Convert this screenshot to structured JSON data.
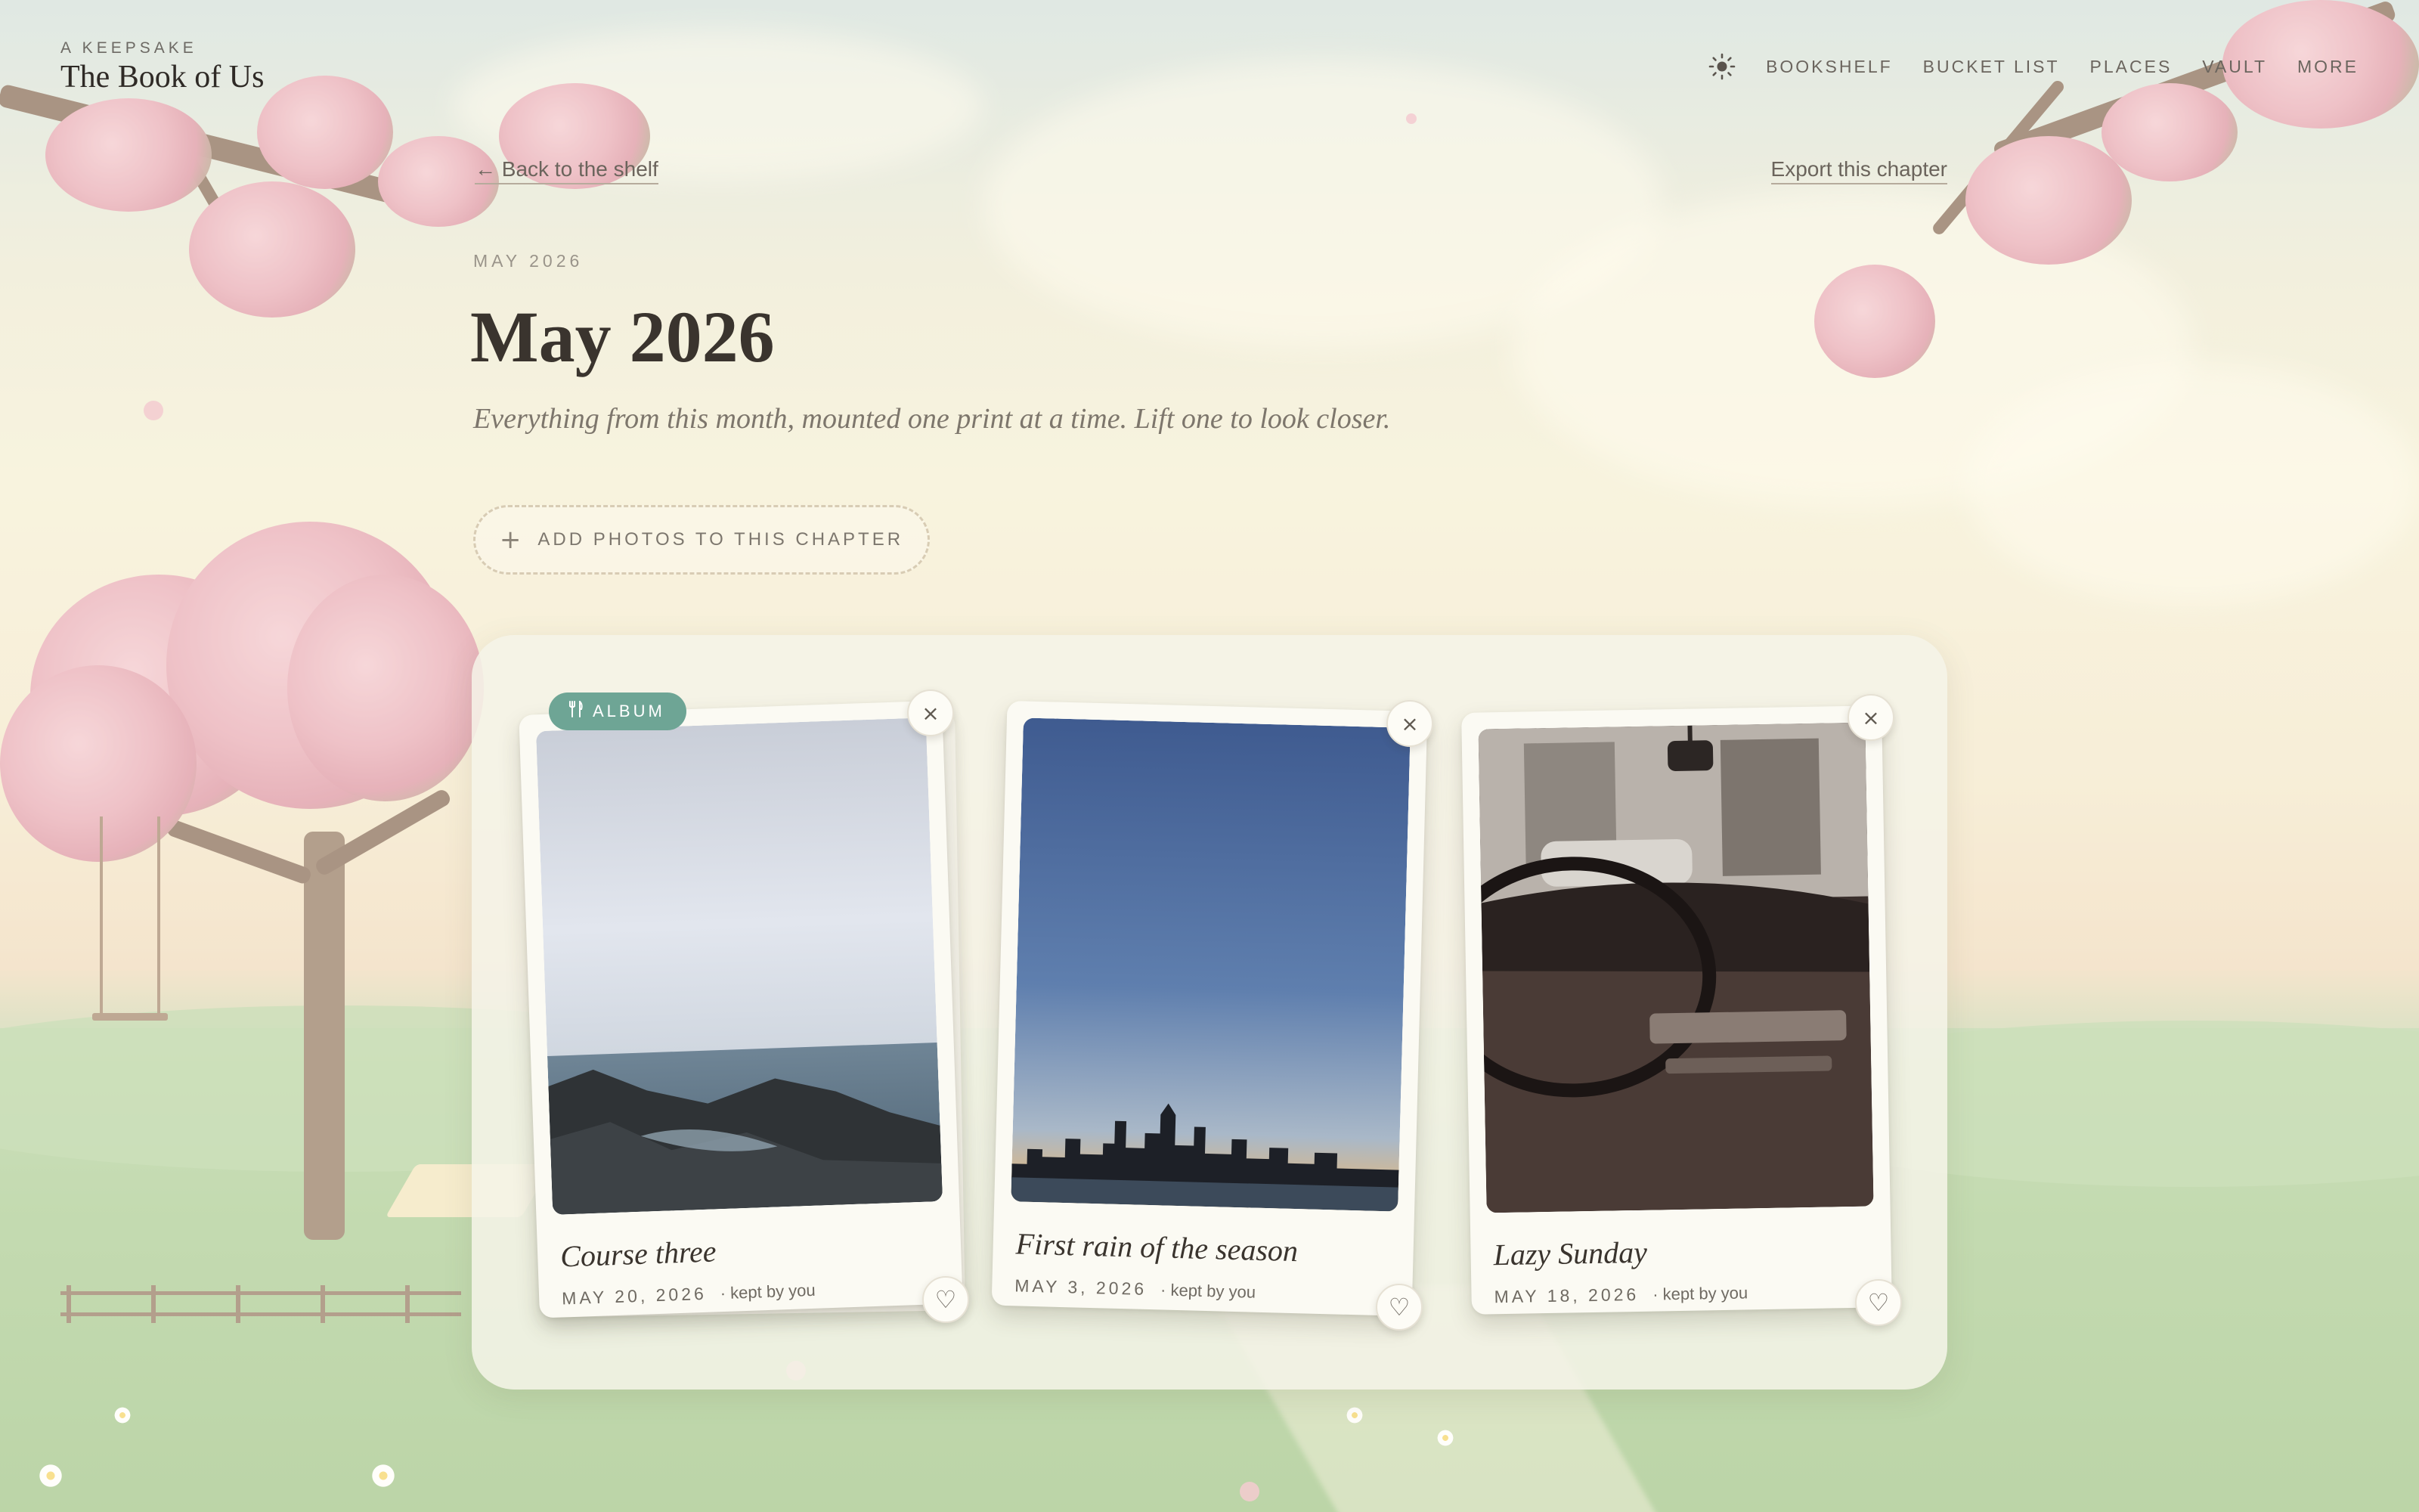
{
  "brand": {
    "kicker": "A KEEPSAKE",
    "title": "The Book of Us"
  },
  "nav": {
    "theme_icon": "sun-icon",
    "items": [
      "BOOKSHELF",
      "BUCKET LIST",
      "PLACES",
      "VAULT",
      "MORE"
    ]
  },
  "links": {
    "back": "← Back to the shelf",
    "export": "Export this chapter"
  },
  "chapter": {
    "kicker": "MAY 2026",
    "title": "May 2026",
    "subtitle": "Everything from this month, mounted one print at a time. Lift one to look closer."
  },
  "add_button": {
    "icon": "+",
    "label": "ADD PHOTOS TO THIS CHAPTER"
  },
  "album_badge": {
    "icon": "fork-knife-icon",
    "label": "ALBUM"
  },
  "cards": [
    {
      "caption": "Course three",
      "date": "MAY 20, 2026",
      "kept": "· kept by you",
      "photo": "rocky-coast"
    },
    {
      "caption": "First rain of the season",
      "date": "MAY 3, 2026",
      "kept": "· kept by you",
      "photo": "city-skyline"
    },
    {
      "caption": "Lazy Sunday",
      "date": "MAY 18, 2026",
      "kept": "· kept by you",
      "photo": "car-interior"
    }
  ],
  "buttons": {
    "remove_glyph": "×",
    "favorite_glyph": "♡"
  },
  "colors": {
    "accent": "#6ea595",
    "ink": "#3a342e",
    "muted": "#6f6a62"
  }
}
